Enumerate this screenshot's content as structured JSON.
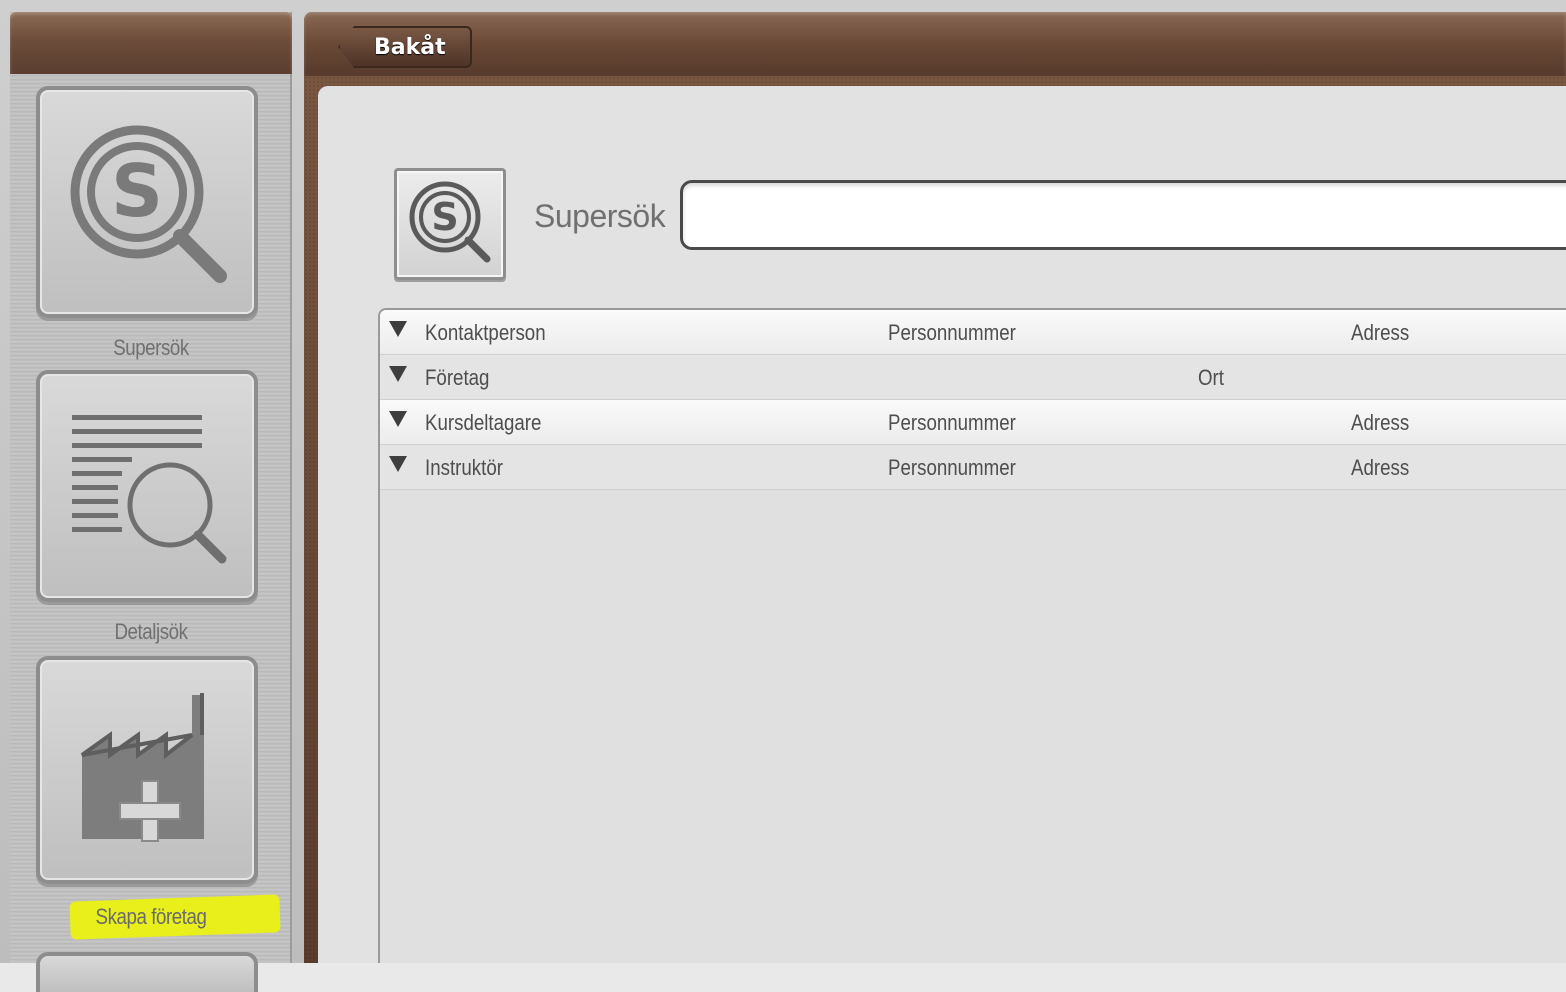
{
  "sidebar": {
    "items": [
      {
        "label": "Supersök",
        "icon": "supersearch-icon"
      },
      {
        "label": "Detaljsök",
        "icon": "detail-search-icon"
      },
      {
        "label": "Skapa företag",
        "icon": "create-company-icon",
        "highlighted": true
      }
    ]
  },
  "topbar": {
    "back_label": "Bakåt"
  },
  "search": {
    "label": "Supersök",
    "value": "",
    "placeholder": ""
  },
  "results": {
    "rows": [
      {
        "title": "Kontaktperson",
        "col2": "Personnummer",
        "col3": "",
        "col4": "Adress"
      },
      {
        "title": "Företag",
        "col2": "",
        "col3": "Ort",
        "col4": ""
      },
      {
        "title": "Kursdeltagare",
        "col2": "Personnummer",
        "col3": "",
        "col4": "Adress"
      },
      {
        "title": "Instruktör",
        "col2": "Personnummer",
        "col3": "",
        "col4": "Adress"
      }
    ]
  },
  "colors": {
    "header_brown": "#6a4936",
    "highlight_yellow": "#e8ef1a",
    "panel_grey": "#e2e2e2"
  }
}
